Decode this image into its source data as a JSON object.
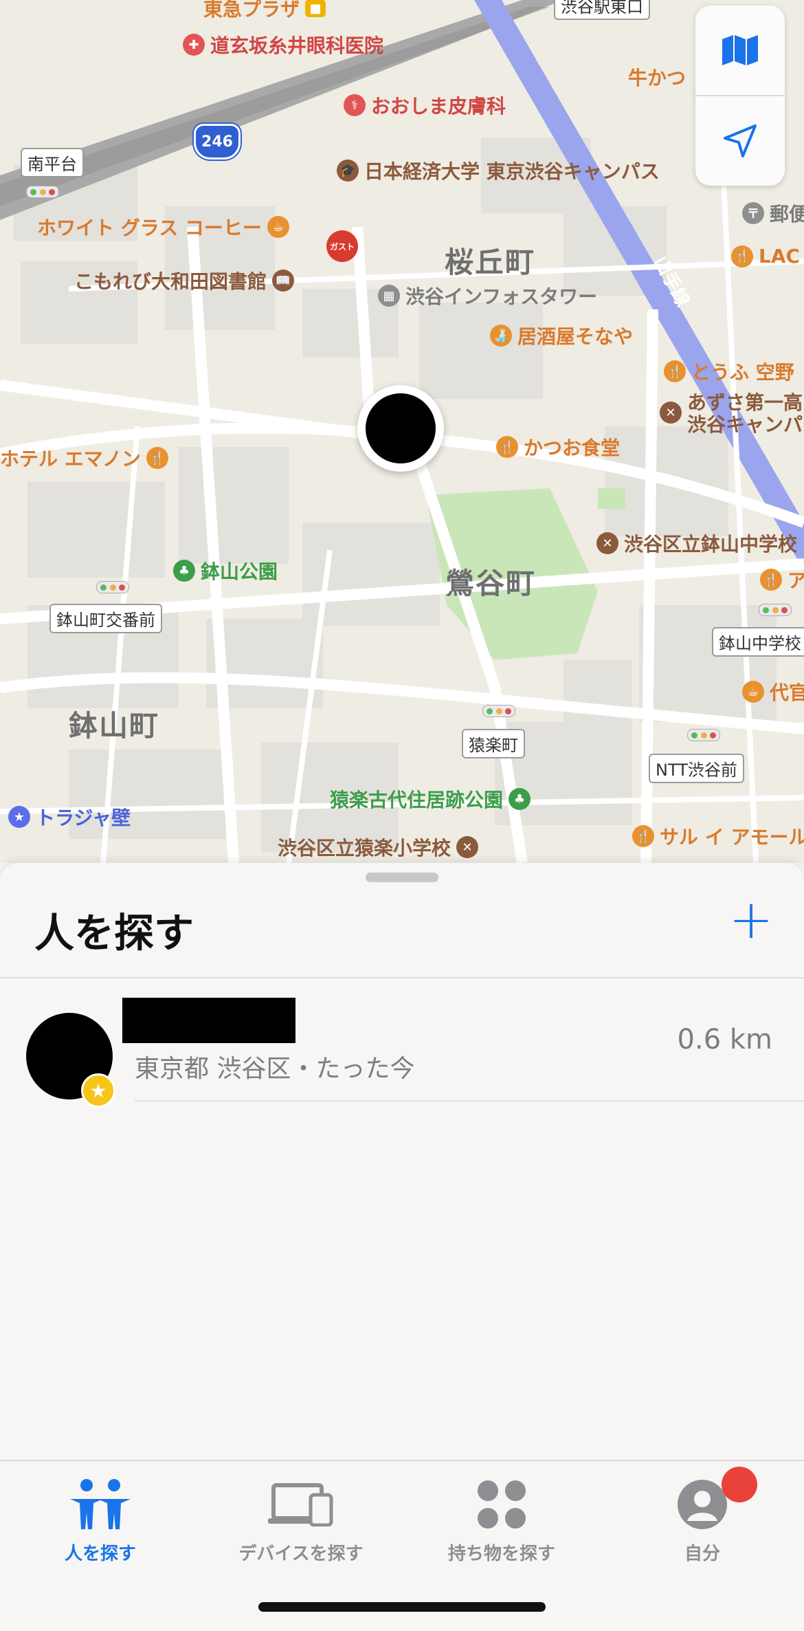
{
  "map": {
    "districts": [
      "桜丘町",
      "鶯谷町",
      "鉢山町"
    ],
    "pois": {
      "tokyu_plaza": "東急プラザ",
      "eye_clinic": "道玄坂糸井眼科医院",
      "derm": "おおしま皮膚科",
      "univ": "日本経済大学 東京渋谷キャンパス",
      "white_grass": "ホワイト グラス コーヒー",
      "gusto": "ガスト",
      "library": "こもれび大和田図書館",
      "info_tower": "渋谷インフォスタワー",
      "izakaya": "居酒屋そなや",
      "katsuo": "かつお食堂",
      "tofu": "とうふ 空野",
      "azusa_line1": "あずさ第一高",
      "azusa_line2": "渋谷キャンパ",
      "hotel": "ホテル エマノン",
      "hachiyama_park": "鉢山公園",
      "hachiyama_jhs": "渋谷区立鉢山中学校",
      "sarugaku_park": "猿楽古代住居跡公園",
      "sarugaku_es": "渋谷区立猿楽小学校",
      "sarai": "サル イ アモール",
      "torajya": "トラジャ壁",
      "gyukatsu": "牛かつ",
      "post": "郵便",
      "lac": "LAC",
      "dai": "代官",
      "a_trunc": "ア",
      "yamanote": "山手線",
      "shibuya_east": "渋谷駅東口"
    },
    "signs": {
      "minamihira": "南平台",
      "hachiyama_koban": "鉢山町交番前",
      "sarugaku": "猿楽町",
      "ntt": "NTT渋谷前",
      "hachiyama_jhs_sign": "鉢山中学校"
    },
    "route_shield": "246",
    "colors": {
      "road": "#ffffff",
      "highway": "#a9a9a9",
      "rail": "#9aa5ee",
      "park": "#c9e6b8",
      "land": "#efece3",
      "block": "#e3e1dc"
    }
  },
  "map_controls": {
    "map_icon": "map-icon",
    "location_icon": "location-arrow-icon"
  },
  "sheet": {
    "title": "人を探す",
    "add_label": "+",
    "people": [
      {
        "name": "",
        "location": "東京都 渋谷区・たった今",
        "distance": "0.6 km"
      }
    ]
  },
  "tabs": [
    {
      "label": "人を探す",
      "icon": "people-icon",
      "active": true
    },
    {
      "label": "デバイスを探す",
      "icon": "devices-icon",
      "active": false
    },
    {
      "label": "持ち物を探す",
      "icon": "items-icon",
      "active": false
    },
    {
      "label": "自分",
      "icon": "me-icon",
      "active": false
    }
  ],
  "colors": {
    "accent": "#1a73e8",
    "badge": "#e8423b"
  }
}
